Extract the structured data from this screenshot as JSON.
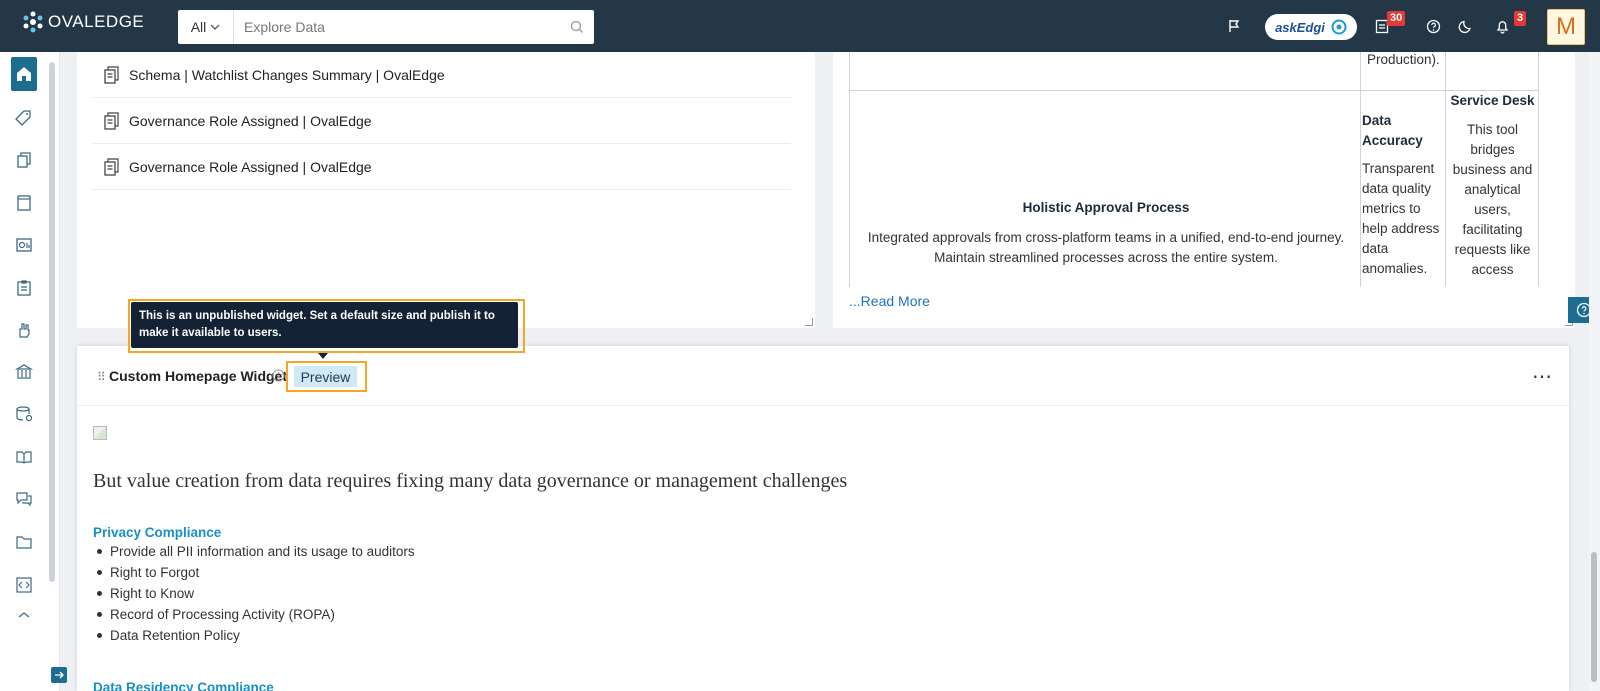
{
  "topbar": {
    "logo": "OVALEDGE",
    "search_scope": "All",
    "search_placeholder": "Explore Data",
    "askedgi_label": "askEdgi",
    "tasks_badge": "30",
    "notifications_badge": "3",
    "avatar_initial": "M"
  },
  "sidebar": {
    "items": [
      "home-icon",
      "tag-icon",
      "documents-icon",
      "book-icon",
      "report-icon",
      "clipboard-icon",
      "hand-icon",
      "bank-icon",
      "database-icon",
      "open-book-icon",
      "chat-icon",
      "folder-icon",
      "code-icon",
      "tree-icon"
    ]
  },
  "left_card": {
    "rows": [
      "Schema | Watchlist Changes Summary | OvalEdge",
      "Governance Role Assigned | OvalEdge",
      "Governance Role Assigned | OvalEdge"
    ]
  },
  "right_card": {
    "top_fragment": "Production).",
    "approval_title": "Holistic Approval Process",
    "approval_text": "Integrated approvals from cross-platform teams in a unified, end-to-end journey. Maintain streamlined processes across the entire system.",
    "accuracy_title": "Data Accuracy",
    "accuracy_text": "Transparent data quality metrics to help address data anomalies.",
    "service_title": "Service Desk",
    "service_text": "This tool bridges business and analytical users, facilitating requests like access",
    "read_more": "...Read More"
  },
  "tooltip": {
    "text": "This is an unpublished widget. Set a default size and publish it to make it available to users."
  },
  "widget": {
    "title": "Custom Homepage Widget",
    "preview_label": "Preview",
    "heading": "But value creation from data requires fixing many data governance or management challenges",
    "section1_title": "Privacy Compliance",
    "section1_items": [
      "Provide all PII information and its usage to auditors",
      "Right to Forgot",
      "Right to Know",
      "Record of Processing Activity (ROPA)",
      "Data Retention Policy"
    ],
    "section2_title": "Data Residency Compliance"
  },
  "colors": {
    "topbar": "#243746",
    "accent": "#1b6e8f",
    "highlight": "#f5a623",
    "link": "#1a8fc4"
  }
}
